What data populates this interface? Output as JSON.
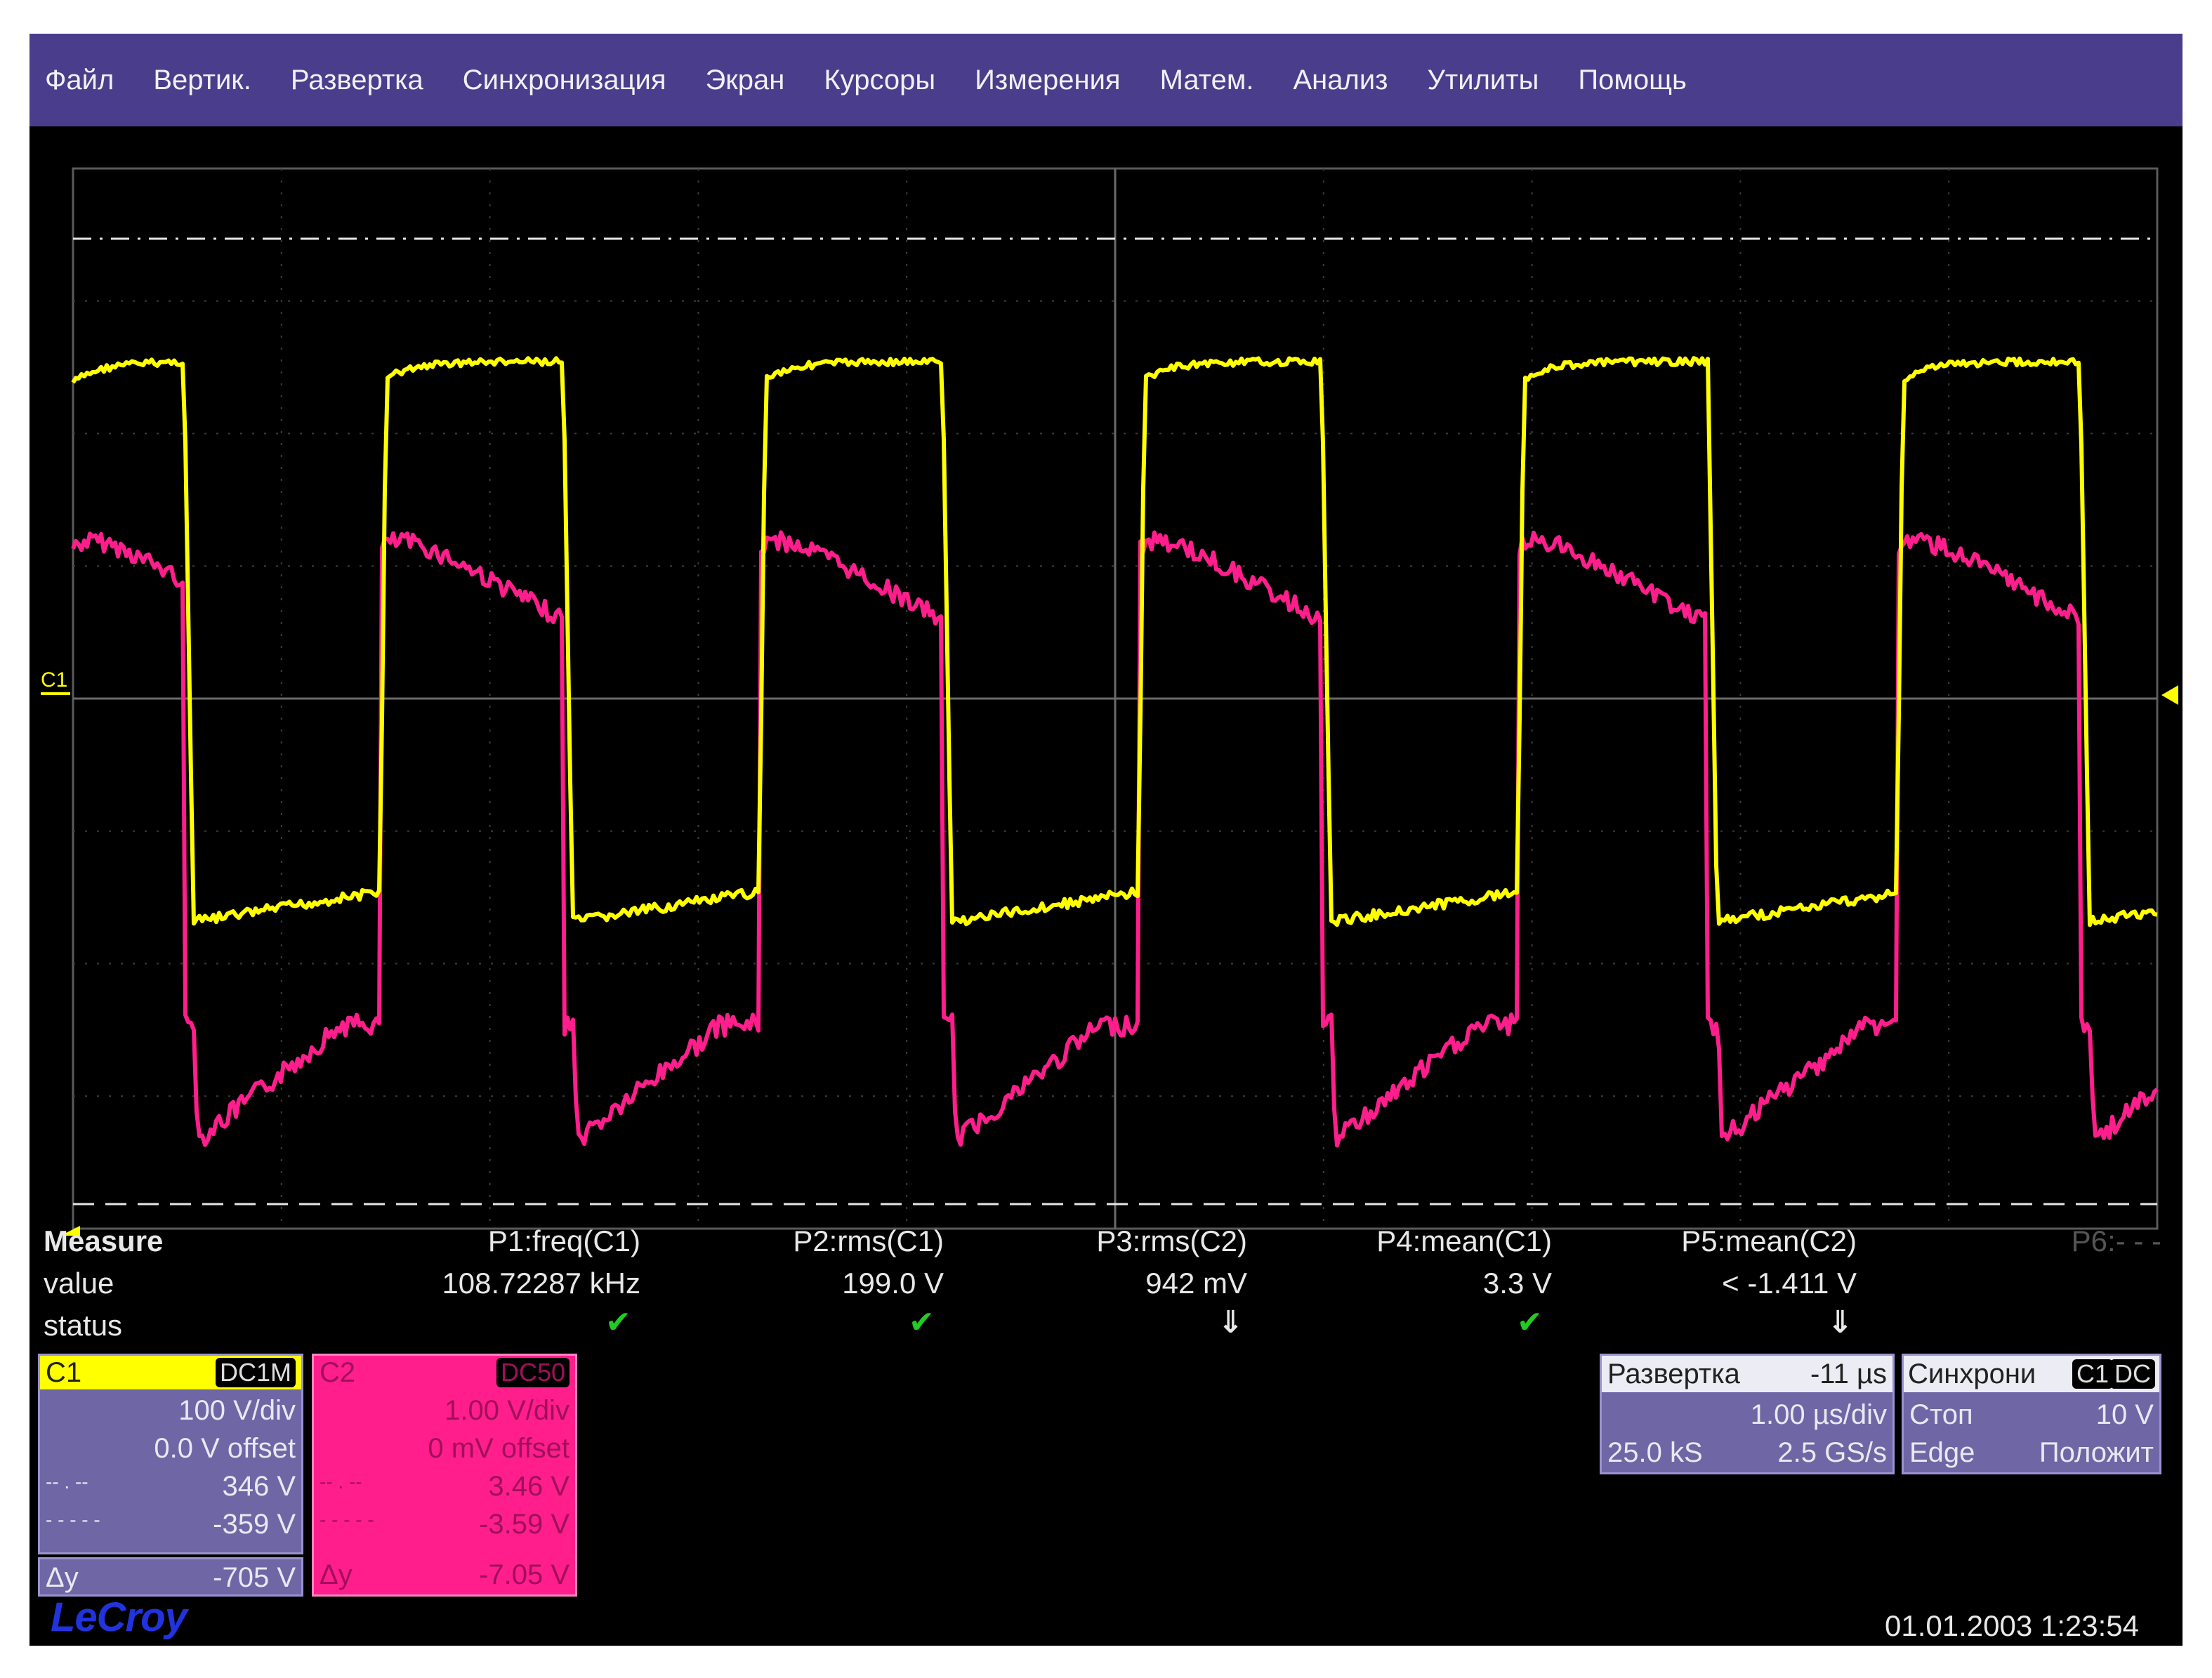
{
  "menu": {
    "items": [
      "Файл",
      "Вертик.",
      "Развертка",
      "Синхронизация",
      "Экран",
      "Курсоры",
      "Измерения",
      "Матем.",
      "Анализ",
      "Утилиты",
      "Помощь"
    ]
  },
  "markers": {
    "channel1_left": "C1"
  },
  "measure": {
    "title": "Measure",
    "row_value": "value",
    "row_status": "status",
    "params": [
      {
        "name": "P1:freq(C1)",
        "value": "108.72287 kHz",
        "status": "ok"
      },
      {
        "name": "P2:rms(C1)",
        "value": "199.0 V",
        "status": "ok"
      },
      {
        "name": "P3:rms(C2)",
        "value": "942 mV",
        "status": "down"
      },
      {
        "name": "P4:mean(C1)",
        "value": "3.3 V",
        "status": "ok"
      },
      {
        "name": "P5:mean(C2)",
        "value": "< -1.411 V",
        "status": "down"
      },
      {
        "name": "P6:- - -",
        "value": "",
        "status": ""
      }
    ]
  },
  "channel1": {
    "name": "C1",
    "coupling": "DC1M",
    "scale": "100 V/div",
    "offset": "0.0 V offset",
    "cursor1_label": "-- . --",
    "cursor1": "346 V",
    "cursor2_label": "- - - - -",
    "cursor2": "-359 V",
    "delta_label": "Δy",
    "delta": "-705 V",
    "color": "#ffff00",
    "panel_color": "#6f66a6"
  },
  "channel2": {
    "name": "C2",
    "coupling": "DC50",
    "scale": "1.00 V/div",
    "offset": "0 mV offset",
    "cursor1_label": "-- . --",
    "cursor1": "3.46 V",
    "cursor2_label": "- - - - -",
    "cursor2": "-3.59 V",
    "delta_label": "Δy",
    "delta": "-7.05 V",
    "color": "#ff1e8c"
  },
  "timebase": {
    "title": "Развертка",
    "delay": "-11 µs",
    "scale": "1.00 µs/div",
    "samples": "25.0 kS",
    "rate": "2.5 GS/s"
  },
  "trigger": {
    "title": "Синхрони",
    "source": "C1",
    "coupling": "DC",
    "mode": "Стоп",
    "level": "10 V",
    "type": "Edge",
    "slope": "Положит"
  },
  "brand": "LeCroy",
  "timestamp": "01.01.2003 1:23:54",
  "colors": {
    "menubar": "#4a3d8c",
    "grid": "#5a5a5a",
    "trace1": "#ffff00",
    "trace2": "#ff1e8c"
  }
}
